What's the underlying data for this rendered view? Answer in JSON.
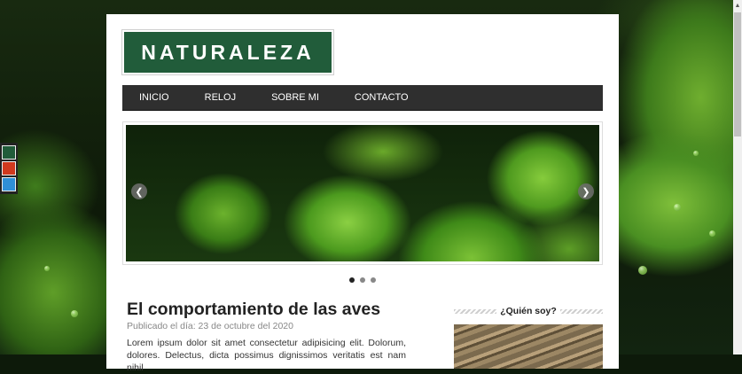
{
  "site": {
    "logo_text": "NATURALEZA"
  },
  "nav": {
    "items": [
      "INICIO",
      "RELOJ",
      "SOBRE MI",
      "CONTACTO"
    ]
  },
  "slider": {
    "slide_count": 3,
    "active_index": 0
  },
  "theme_switcher": {
    "colors": [
      "#215c3a",
      "#d0391e",
      "#2f8fd6"
    ]
  },
  "post": {
    "title": "El comportamiento de las aves",
    "date": "Publicado el día: 23 de octubre del 2020",
    "excerpt": "Lorem ipsum dolor sit amet consectetur adipisicing elit. Dolorum, dolores. Delectus, dicta possimus dignissimos veritatis est nam nihil"
  },
  "sidebar": {
    "widget_title": "¿Quién soy?"
  }
}
